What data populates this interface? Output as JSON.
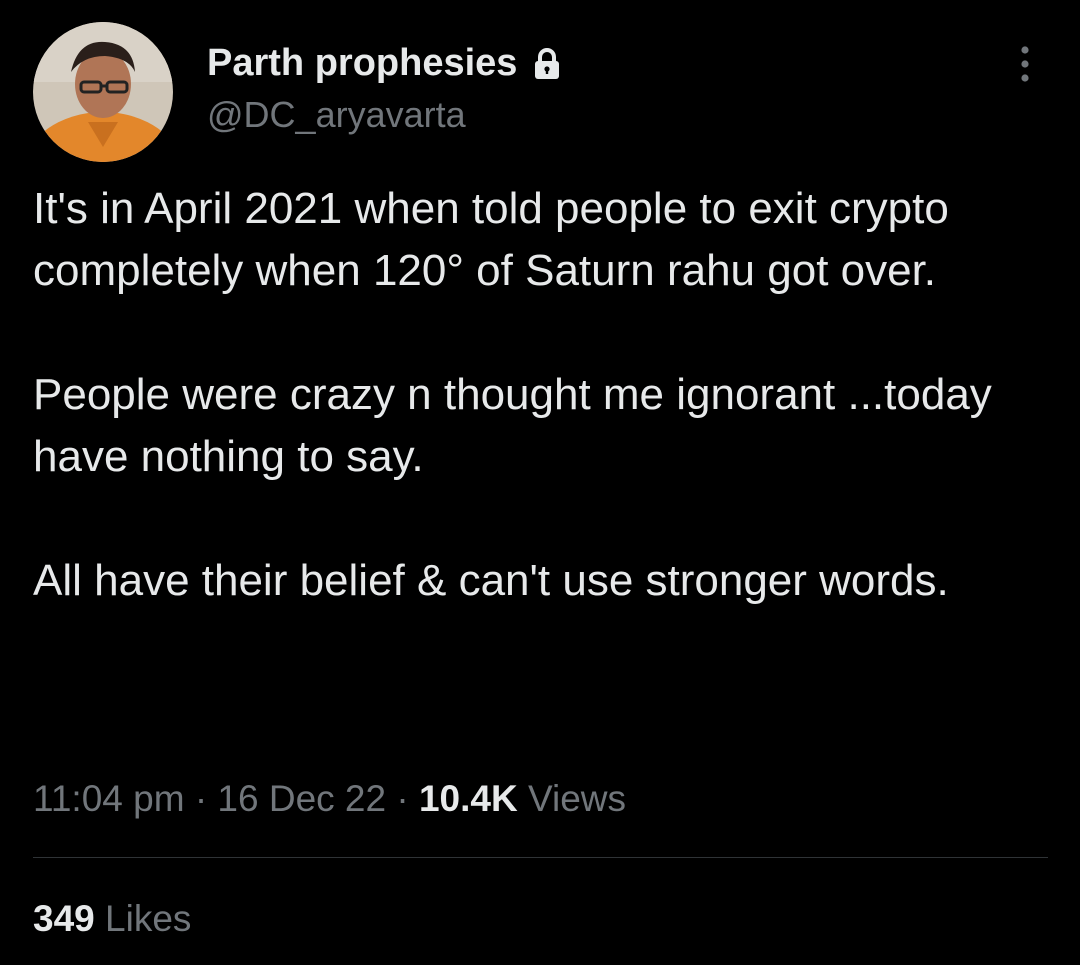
{
  "author": {
    "display_name": "Parth prophesies",
    "handle": "@DC_aryavarta",
    "avatar_icon": "profile-photo",
    "protected_icon": "lock-icon"
  },
  "tweet": {
    "paragraphs": [
      "It's in April 2021 when told people to exit crypto completely when 120° of Saturn rahu got over.",
      "People were crazy n thought me ignorant ...today have nothing to say.",
      "All have their belief & can't use stronger words."
    ],
    "time": "11:04 pm",
    "date": "16 Dec 22",
    "separator": "·",
    "views_count": "10.4K",
    "views_label": "Views",
    "likes_count": "349",
    "likes_label": "Likes"
  },
  "colors": {
    "background": "#000000",
    "primary_text": "#e7e9ea",
    "secondary_text": "#71767b",
    "divider": "#2f3336"
  }
}
